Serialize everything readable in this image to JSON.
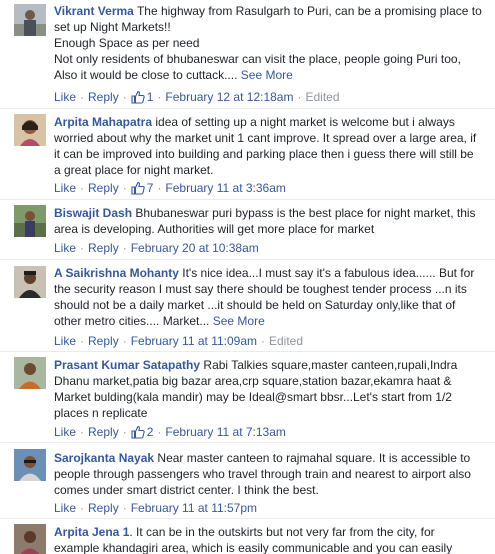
{
  "comments": [
    {
      "name": "Vikrant Verma",
      "text": " The highway from Rasulgarh to Puri, can be a promising place to set up Night Markets!!\nEnough Space as per need\nNot only residents of bhubaneswar can visit the place, people going Puri too, Also it would be close to cuttack.... ",
      "more": "See More",
      "like": "Like",
      "reply": "Reply",
      "likes": "1",
      "time": "February 12 at 12:18am",
      "edited": "Edited"
    },
    {
      "name": "Arpita Mahapatra",
      "text": " idea of setting up a night market is welcome but i always worried about why the market unit 1 cant improve. It spread over a large area, if it can be improved into building and parking place then i guess there will still be a great place for night market.",
      "like": "Like",
      "reply": "Reply",
      "likes": "7",
      "time": "February 11 at 3:36am"
    },
    {
      "name": "Biswajit Dash",
      "text": " Bhubaneswar puri bypass is the best place for night market, this area is developing. Authorities will get more place for market",
      "like": "Like",
      "reply": "Reply",
      "time": "February 20 at 10:38am"
    },
    {
      "name": "A Saikrishna Mohanty",
      "text": " It's nice idea...I must say it's a fabulous idea...... But for the security reason I must say there should be toughest tender process ...n its should not be a daily market ...it should be held on Saturday only,like that of other metro cities.... Market... ",
      "more": "See More",
      "like": "Like",
      "reply": "Reply",
      "time": "February 11 at 11:09am",
      "edited": "Edited"
    },
    {
      "name": "Prasant Kumar Satapathy",
      "text": " Rabi Talkies square,master canteen,rupali,Indra Dhanu market,patia big bazar area,crp square,station bazar,ekamra haat & Market bulding(kala mandir) may be Ideal@smart bbsr...Let's start from 1/2 places n replicate",
      "like": "Like",
      "reply": "Reply",
      "likes": "2",
      "time": "February 11 at 7:13am"
    },
    {
      "name": "Sarojkanta Nayak",
      "text": " Near master canteen to rajmahal square. It is accessible to people through passengers who travel through train and nearest to airport also comes under smart district center. I think the best.",
      "like": "Like",
      "reply": "Reply",
      "time": "February 11 at 11:57pm"
    },
    {
      "name": "Arpita Jena 1",
      "text": ". It can be in the outskirts but not very far from the city, for example khandagiri area, which is easily communicable and you can easily"
    }
  ],
  "colors": {
    "link": "#365899",
    "meta": "#90949c",
    "text": "#1d2129",
    "divider": "#e9ebee"
  },
  "icons": {
    "like": "thumbs-up-icon"
  }
}
